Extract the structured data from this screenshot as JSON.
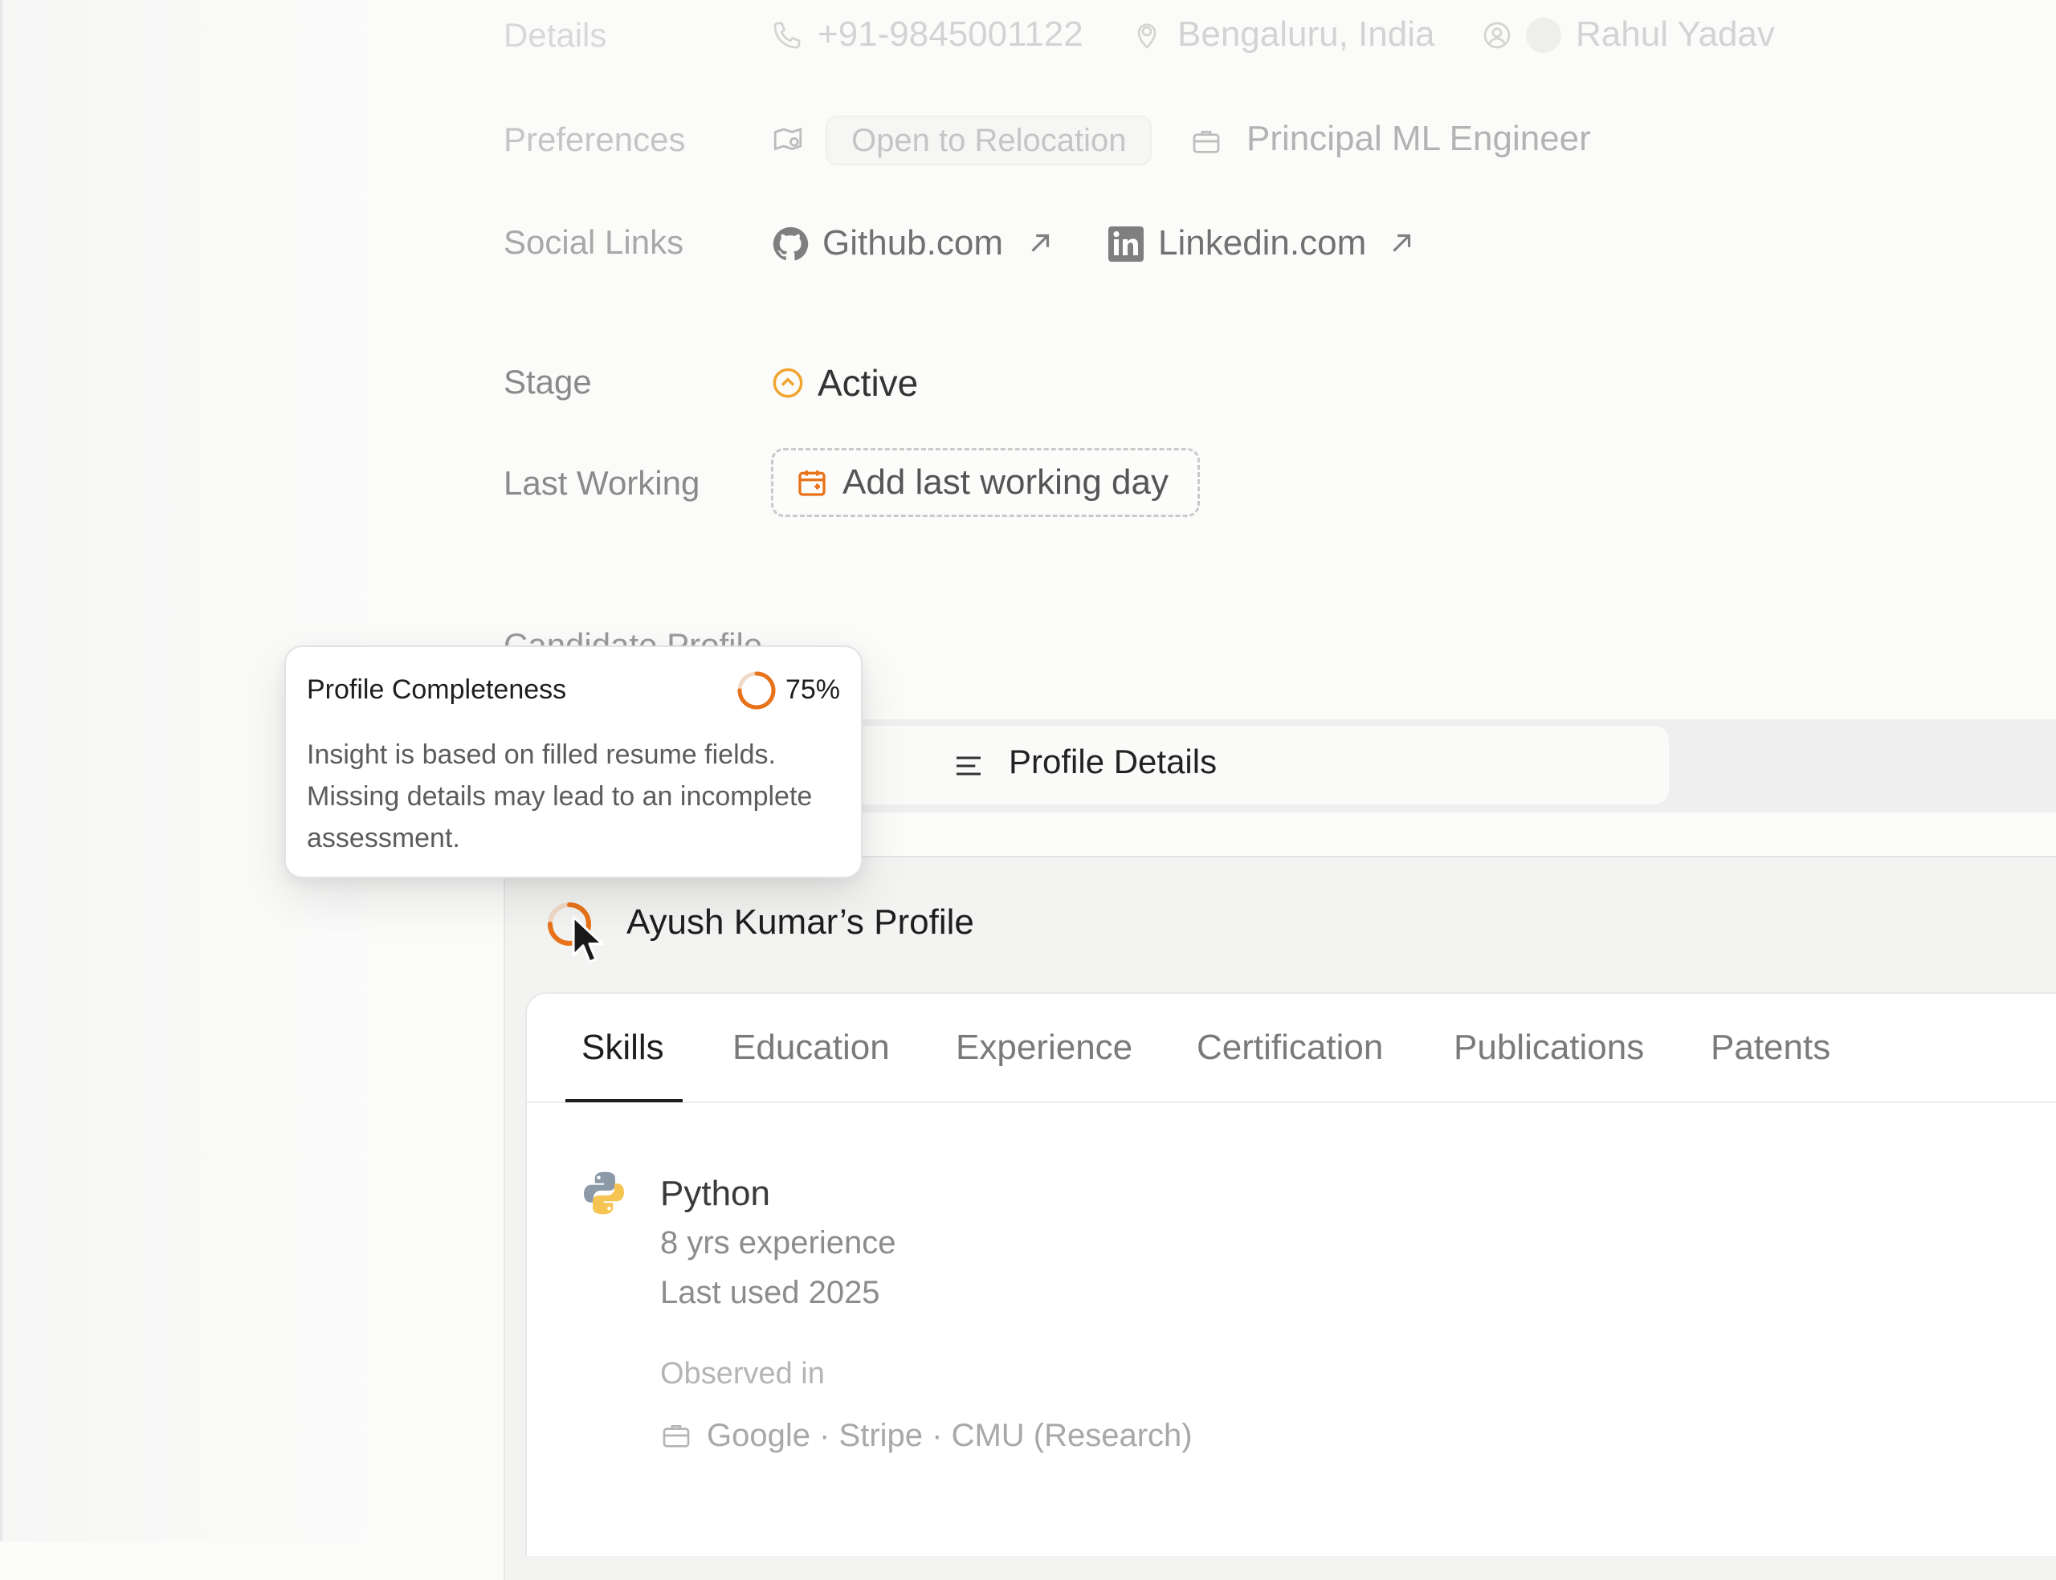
{
  "details": {
    "label": "Details",
    "phone": "+91-9845001122",
    "location": "Bengaluru, India",
    "recruiter": "Rahul Yadav"
  },
  "preferences": {
    "label": "Preferences",
    "relocation_chip": "Open to Relocation",
    "role": "Principal ML Engineer"
  },
  "social": {
    "label": "Social Links",
    "github": "Github.com",
    "linkedin": "Linkedin.com"
  },
  "stage": {
    "label": "Stage",
    "value": "Active",
    "color": "#f0a531"
  },
  "last_working": {
    "label": "Last Working",
    "button": "Add last working day",
    "icon_color": "#e8731a"
  },
  "candidate_profile": {
    "label": "Candidate Profile"
  },
  "profile_tab": {
    "label": "Profile Details"
  },
  "profile": {
    "title": "Ayush Kumar’s Profile",
    "tabs": [
      "Skills",
      "Education",
      "Experience",
      "Certification",
      "Publications",
      "Patents"
    ],
    "active_tab": "Skills"
  },
  "skill": {
    "name": "Python",
    "experience": "8 yrs experience",
    "last_used": "Last used 2025",
    "observed_label": "Observed in",
    "observed_in": "Google · Stripe · CMU (Research)"
  },
  "tooltip": {
    "title": "Profile Completeness",
    "percent_text": "75%",
    "percent": 0.75,
    "body_lines": [
      "Insight is based on filled resume fields.",
      "Missing details may lead to an incomplete",
      "assessment."
    ]
  },
  "colors": {
    "accent_orange": "#e8731a",
    "ring_track": "#f1d9c6"
  },
  "icons": {
    "phone": "phone-icon",
    "location": "location-pin-icon",
    "recruiter": "user-circle-icon",
    "relocation": "map-pin-icon",
    "role": "briefcase-icon",
    "github": "github-icon",
    "linkedin": "linkedin-icon",
    "external": "arrow-up-right-icon",
    "stage": "chevron-up-circle-icon",
    "calendar": "calendar-icon",
    "profile_details": "text-lines-icon",
    "python": "python-logo-icon",
    "cursor": "cursor-arrow-icon"
  }
}
